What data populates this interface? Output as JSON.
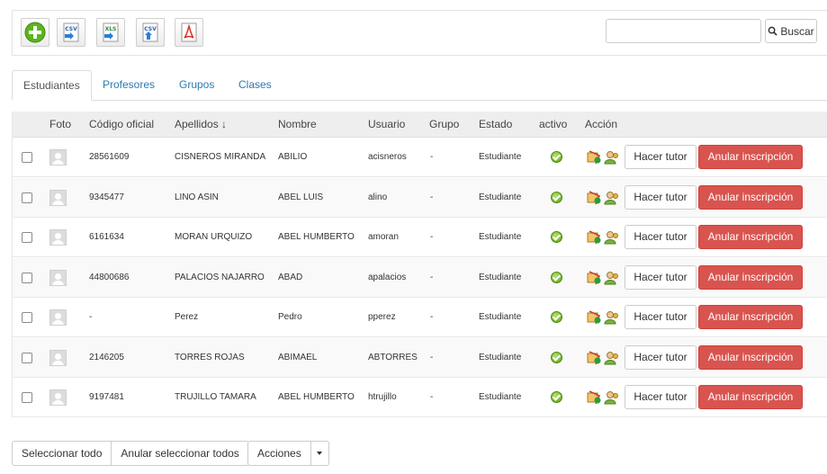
{
  "toolbar": {
    "buttons": [
      {
        "name": "add-button",
        "icon": "plus-circle-icon"
      },
      {
        "name": "import-csv-button",
        "icon": "csv-import-icon",
        "label": "CSV"
      },
      {
        "name": "import-xls-button",
        "icon": "xls-import-icon",
        "label": "XLS"
      },
      {
        "name": "export-csv-button",
        "icon": "csv-export-icon",
        "label": "CSV"
      },
      {
        "name": "export-pdf-button",
        "icon": "pdf-icon"
      }
    ],
    "search_value": "",
    "search_label": "Buscar"
  },
  "tabs": [
    "Estudiantes",
    "Profesores",
    "Grupos",
    "Clases"
  ],
  "table": {
    "headers": {
      "foto": "Foto",
      "codigo": "Código oficial",
      "apellidos": "Apellidos ↓",
      "nombre": "Nombre",
      "usuario": "Usuario",
      "grupo": "Grupo",
      "estado": "Estado",
      "activo": "activo",
      "accion": "Acción"
    },
    "rows": [
      {
        "codigo": "28561609",
        "apellidos": "CISNEROS MIRANDA",
        "nombre": "ABILIO",
        "usuario": "acisneros",
        "grupo": "-",
        "estado": "Estudiante"
      },
      {
        "codigo": "9345477",
        "apellidos": "LINO ASIN",
        "nombre": "ABEL LUIS",
        "usuario": "alino",
        "grupo": "-",
        "estado": "Estudiante"
      },
      {
        "codigo": "6161634",
        "apellidos": "MORAN URQUIZO",
        "nombre": "ABEL HUMBERTO",
        "usuario": "amoran",
        "grupo": "-",
        "estado": "Estudiante"
      },
      {
        "codigo": "44800686",
        "apellidos": "PALACIOS NAJARRO",
        "nombre": "ABAD",
        "usuario": "apalacios",
        "grupo": "-",
        "estado": "Estudiante"
      },
      {
        "codigo": "-",
        "apellidos": "Perez",
        "nombre": "Pedro",
        "usuario": "pperez",
        "grupo": "-",
        "estado": "Estudiante"
      },
      {
        "codigo": "2146205",
        "apellidos": "TORRES ROJAS",
        "nombre": "ABIMAEL",
        "usuario": "ABTORRES",
        "grupo": "-",
        "estado": "Estudiante"
      },
      {
        "codigo": "9197481",
        "apellidos": "TRUJILLO TAMARA",
        "nombre": "ABEL HUMBERTO",
        "usuario": "htrujillo",
        "grupo": "-",
        "estado": "Estudiante"
      }
    ],
    "tutor_label": "Hacer tutor",
    "unenroll_label": "Anular inscripción"
  },
  "bottom": {
    "select_all": "Seleccionar todo",
    "deselect_all": "Anular seleccionar todos",
    "actions": "Acciones"
  },
  "colors": {
    "link": "#2a7ab0",
    "danger": "#d9534f",
    "header_bg": "#eeeeee"
  }
}
